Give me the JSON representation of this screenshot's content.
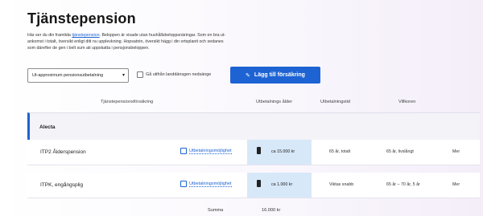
{
  "page_title": "Tjänstepension",
  "intro": {
    "line1_prefix": "Här ser du din framtida ",
    "line1_link": "tjänstepension",
    "line1_suffix": ". Beloppen är visade utan hushållsbeloppsnäringar. Som en bra ut-",
    "line2": "ankomst i totalt, översikt enligt ditt nu upplevkning. Hopsatnin, översikt hägg i din ortsplanit och sedanes",
    "line3": "som därefter de gen i belt sum ati uppskatta i pensjonsbeloppen."
  },
  "controls": {
    "select_value": "Ut-approximum pensionsutbetalning",
    "checkbox_label": "Gå utifrån landdänsgen nedsänge",
    "add_button_label": "Lägg till försäkring"
  },
  "table": {
    "columns": [
      "Tjänstepensionsförsäkring",
      "Utbetalnings ålder",
      "Utbetalningstid",
      "Villkoren"
    ],
    "group_label": "Alecta",
    "rows": [
      {
        "name": "ITP2 Ålderspension",
        "editor_label": "Utbetalningsmöjlighet",
        "share_value": "ca 15.000 kr",
        "col1": "65 år, totalt",
        "col2": "65 år, livslångt",
        "col3": "Mer"
      },
      {
        "name": "ITPK, engångsplig",
        "editor_label": "Utbetalningsmöjlighet",
        "share_value": "ca 1.000 kr",
        "col1": "Viktas snabb",
        "col2": "65 år – 70 år, 5 år",
        "col3": "Mer"
      }
    ]
  },
  "footer": {
    "label": "Summa",
    "value": "16.000 kr"
  },
  "colors": {
    "accent": "#1d63d3",
    "highlight": "#d7e8f8"
  }
}
